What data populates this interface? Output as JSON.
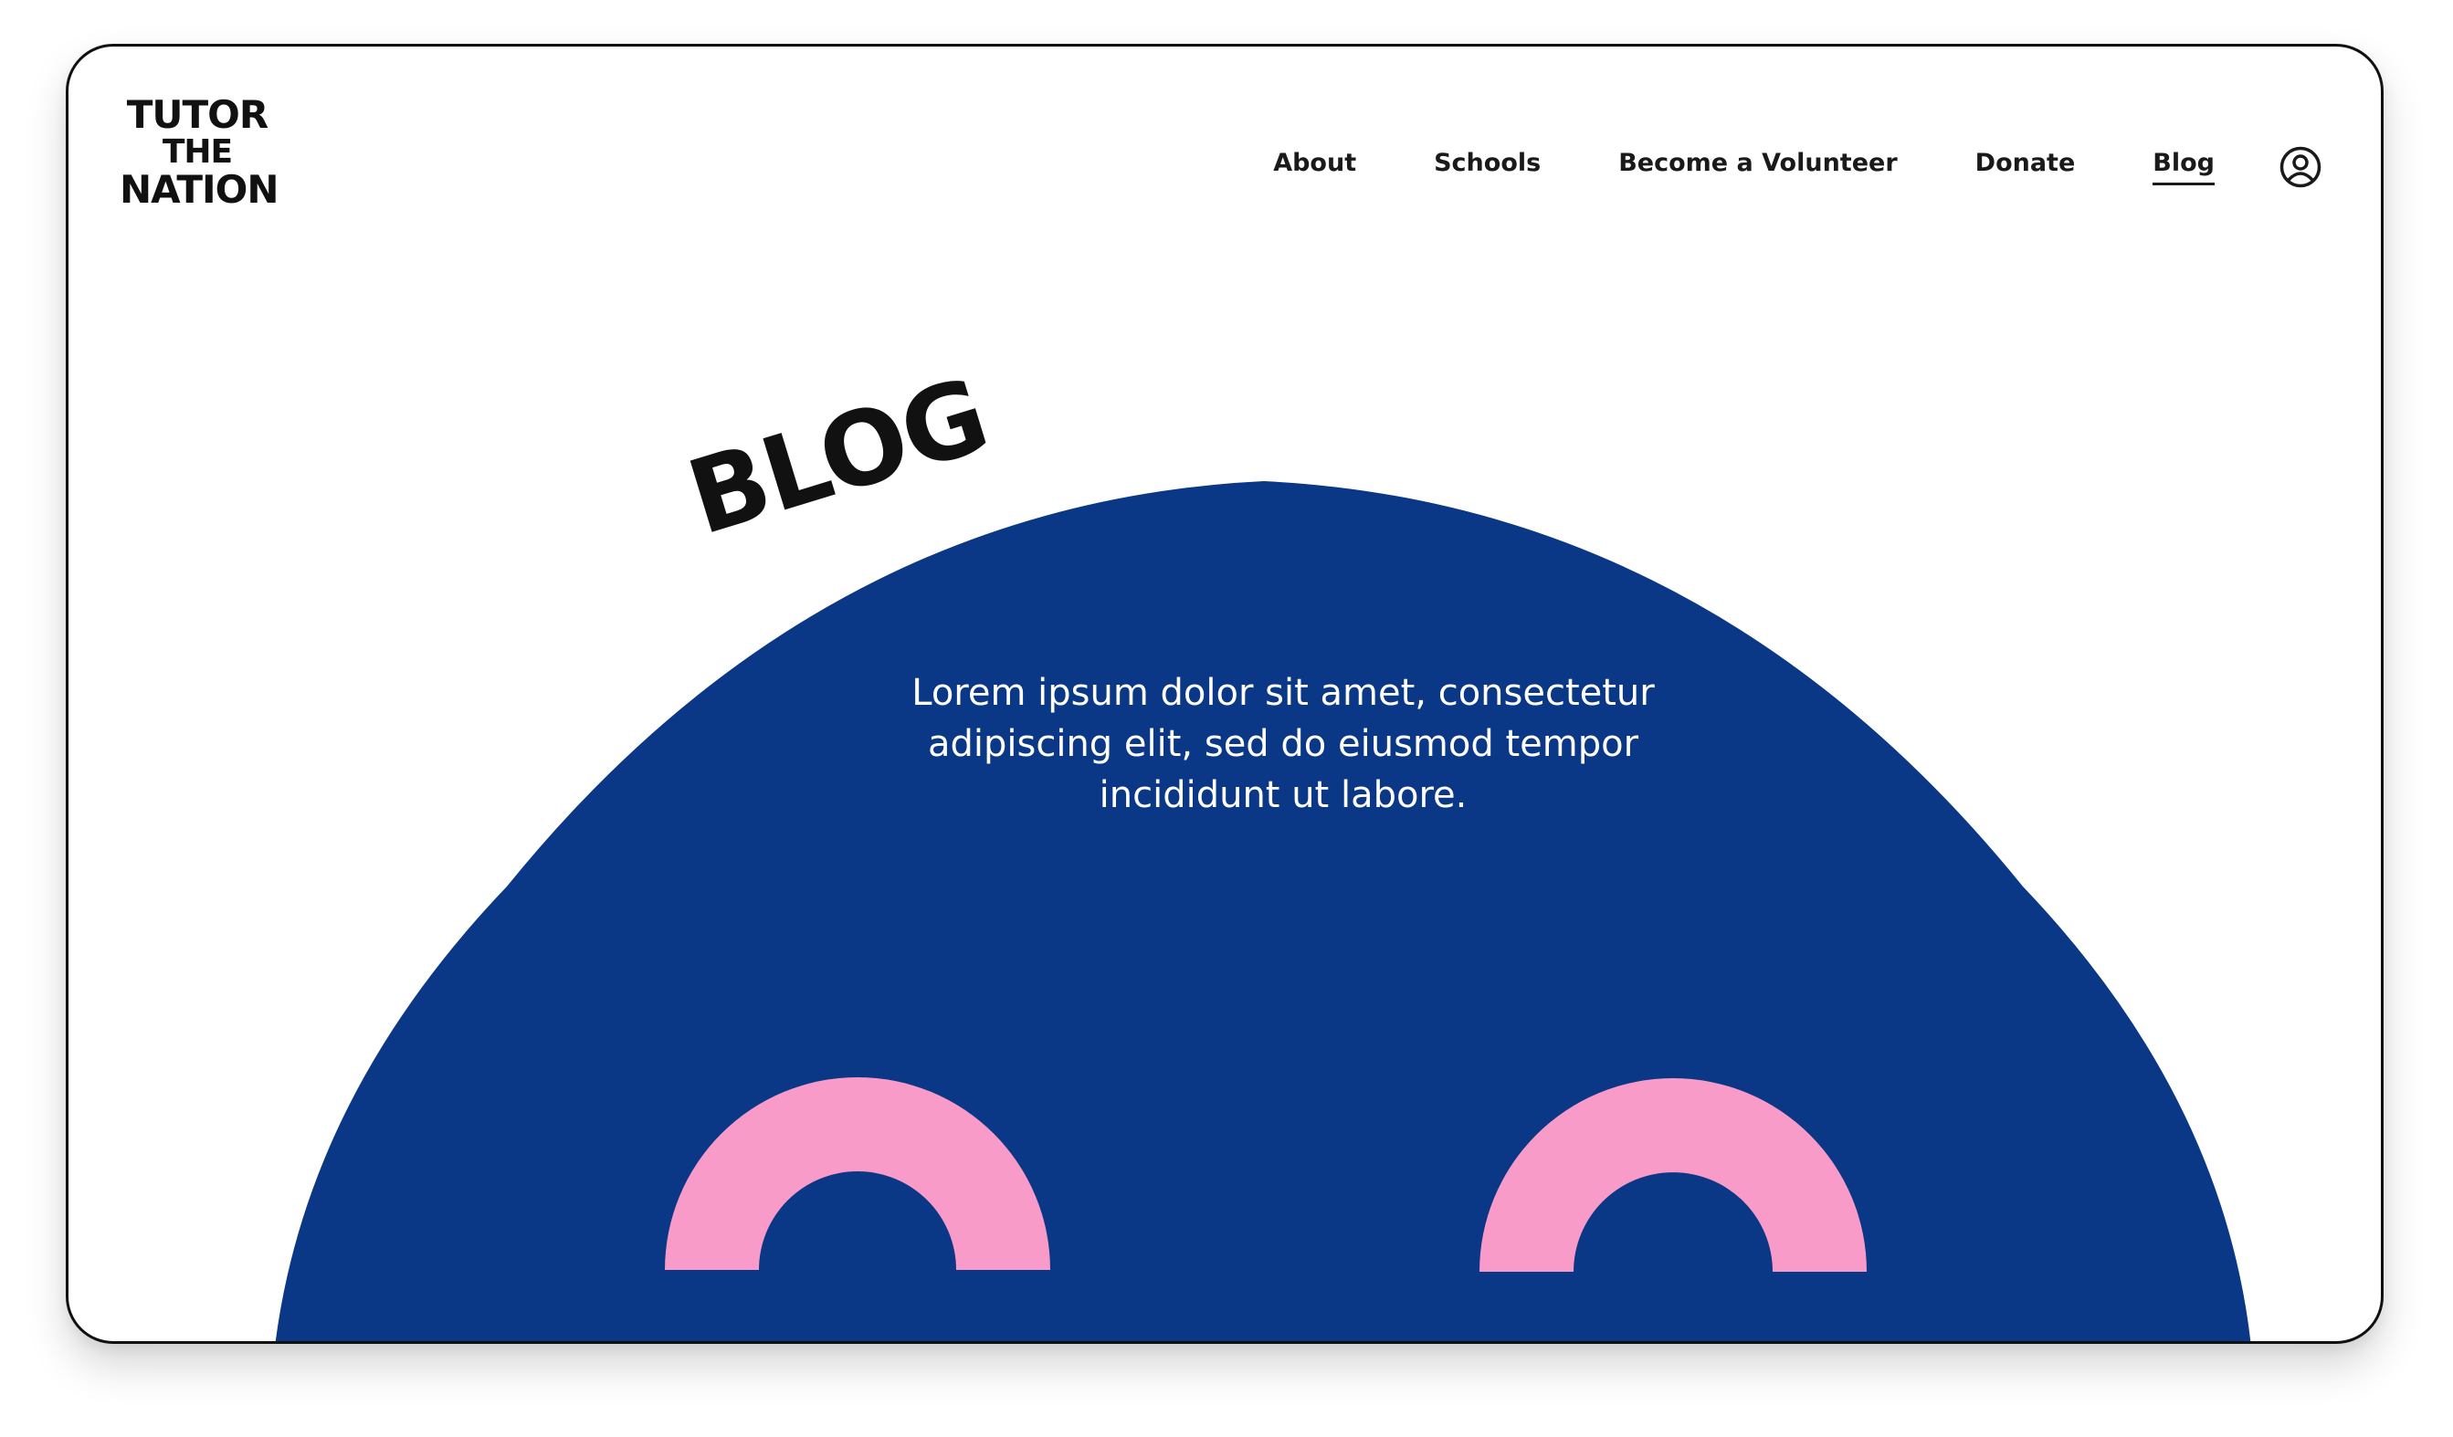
{
  "brand": {
    "logo_line1": "TUTOR",
    "logo_line2": "THE",
    "logo_line3": "NATION"
  },
  "nav": {
    "items": [
      {
        "label": "About",
        "active": false
      },
      {
        "label": "Schools",
        "active": false
      },
      {
        "label": "Become a Volunteer",
        "active": false
      },
      {
        "label": "Donate",
        "active": false
      },
      {
        "label": "Blog",
        "active": true
      }
    ],
    "account_icon": "user-circle-icon"
  },
  "hero": {
    "heading": "BLOG",
    "description": "Lorem ipsum dolor sit amet, consectetur adipiscing elit, sed do eiusmod tempor incididunt ut labore."
  },
  "colors": {
    "navy": "#0a3786",
    "pink": "#f99bc8",
    "text": "#111111",
    "background": "#ffffff"
  }
}
